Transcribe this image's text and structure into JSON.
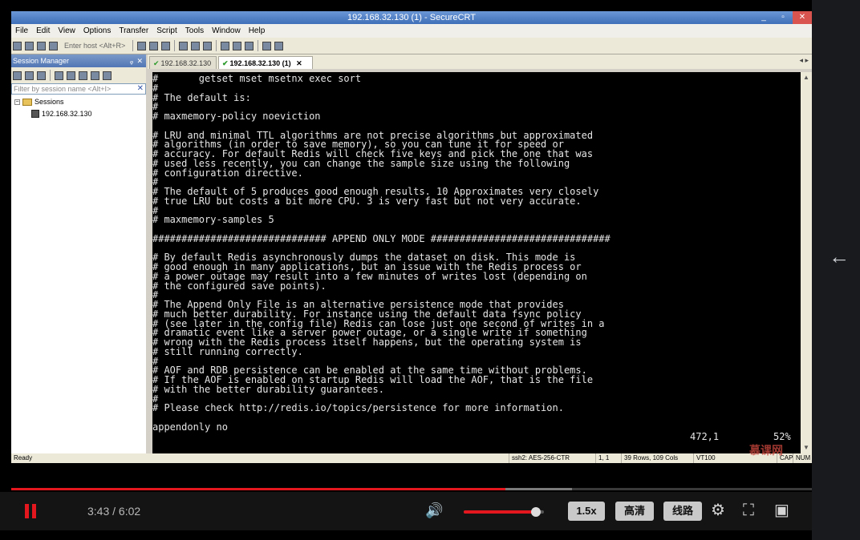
{
  "window": {
    "title": "192.168.32.130 (1) - SecureCRT",
    "min": "_",
    "restore": "▫",
    "close": "✕"
  },
  "menu": [
    "File",
    "Edit",
    "View",
    "Options",
    "Transfer",
    "Script",
    "Tools",
    "Window",
    "Help"
  ],
  "toolbar": {
    "host_placeholder": "Enter host <Alt+R>"
  },
  "session_manager": {
    "title": "Session Manager",
    "pin": "ᵩ",
    "close": "✕",
    "filter_placeholder": "Filter by session name <Alt+I>",
    "filter_clear": "✕",
    "tree": {
      "expand": "−",
      "folder_label": "Sessions",
      "items": [
        "192.168.32.130"
      ]
    }
  },
  "tabs": [
    {
      "label": "192.168.32.130",
      "active": false,
      "check": "✔"
    },
    {
      "label": "192.168.32.130 (1)",
      "active": true,
      "check": "✔",
      "close": "✕"
    }
  ],
  "tab_nav": "◂ ▸",
  "terminal": {
    "lines": [
      "#       getset mset msetnx exec sort",
      "#",
      "# The default is:",
      "#",
      "# maxmemory-policy noeviction",
      "",
      "# LRU and minimal TTL algorithms are not precise algorithms but approximated",
      "# algorithms (in order to save memory), so you can tune it for speed or",
      "# accuracy. For default Redis will check five keys and pick the one that was",
      "# used less recently, you can change the sample size using the following",
      "# configuration directive.",
      "#",
      "# The default of 5 produces good enough results. 10 Approximates very closely",
      "# true LRU but costs a bit more CPU. 3 is very fast but not very accurate.",
      "#",
      "# maxmemory-samples 5",
      "",
      "############################## APPEND ONLY MODE ###############################",
      "",
      "# By default Redis asynchronously dumps the dataset on disk. This mode is",
      "# good enough in many applications, but an issue with the Redis process or",
      "# a power outage may result into a few minutes of writes lost (depending on",
      "# the configured save points).",
      "#",
      "# The Append Only File is an alternative persistence mode that provides",
      "# much better durability. For instance using the default data fsync policy",
      "# (see later in the config file) Redis can lose just one second of writes in a",
      "# dramatic event like a server power outage, or a single write if something",
      "# wrong with the Redis process itself happens, but the operating system is",
      "# still running correctly.",
      "#",
      "# AOF and RDB persistence can be enabled at the same time without problems.",
      "# If the AOF is enabled on startup Redis will load the AOF, that is the file",
      "# with the better durability guarantees.",
      "#",
      "# Please check http://redis.io/topics/persistence for more information.",
      "",
      "appendonly no"
    ],
    "cursor_pos": "472,1",
    "scroll_pct": "52%"
  },
  "statusbar": {
    "ready": "Ready",
    "cipher": "ssh2: AES-256-CTR",
    "pos": "1,  1",
    "size": "39 Rows, 109 Cols",
    "term": "VT100",
    "caps": "CAP",
    "num": "NUM"
  },
  "watermark": "慕课网",
  "player": {
    "current": "3:43",
    "duration": "6:02",
    "time_display": "3:43 / 6:02",
    "progress_fraction": 0.6177,
    "buffer_fraction": 0.7,
    "volume_fraction": 0.9,
    "speed_label": "1.5x",
    "quality_label": "高清",
    "route_label": "线路",
    "icons": {
      "volume": "🔊",
      "settings": "⚙",
      "fullscreen": "⛶",
      "pip": "▣",
      "back": "←"
    }
  }
}
